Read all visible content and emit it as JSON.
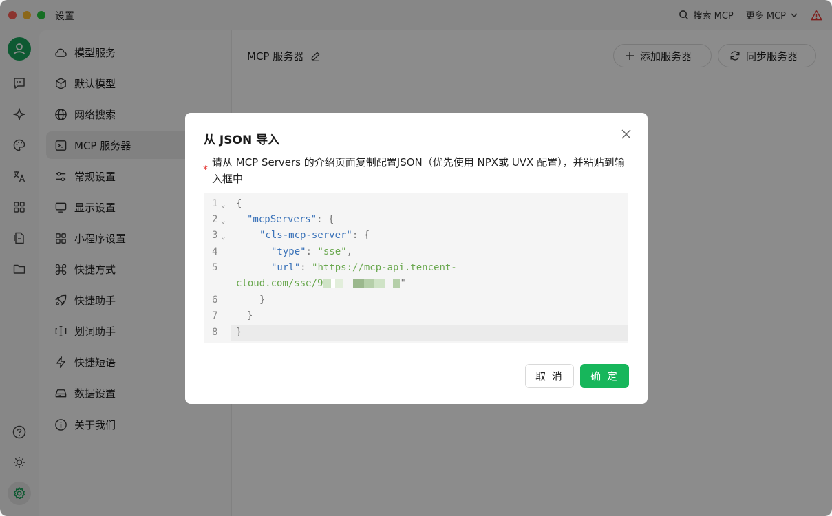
{
  "window": {
    "title": "设置"
  },
  "titlebar": {
    "search_mcp": "搜索 MCP",
    "more_mcp": "更多 MCP"
  },
  "rail": {
    "icons": [
      "user-icon",
      "chat-icon",
      "sparkle-icon",
      "palette-icon",
      "translate-icon",
      "apps-icon",
      "file-icon",
      "folder-icon",
      "help-icon",
      "brightness-icon",
      "settings-icon"
    ]
  },
  "nav": {
    "items": [
      {
        "label": "模型服务",
        "icon": "cloud-icon"
      },
      {
        "label": "默认模型",
        "icon": "cube-icon"
      },
      {
        "label": "网络搜索",
        "icon": "globe-icon"
      },
      {
        "label": "MCP 服务器",
        "icon": "terminal-icon",
        "active": true
      },
      {
        "label": "常规设置",
        "icon": "sliders-icon"
      },
      {
        "label": "显示设置",
        "icon": "monitor-icon"
      },
      {
        "label": "小程序设置",
        "icon": "grid-icon"
      },
      {
        "label": "快捷方式",
        "icon": "command-icon"
      },
      {
        "label": "快捷助手",
        "icon": "rocket-icon"
      },
      {
        "label": "划词助手",
        "icon": "text-cursor-icon"
      },
      {
        "label": "快捷短语",
        "icon": "zap-icon"
      },
      {
        "label": "数据设置",
        "icon": "hard-drive-icon"
      },
      {
        "label": "关于我们",
        "icon": "info-icon"
      }
    ]
  },
  "main": {
    "title": "MCP 服务器",
    "add_server": "添加服务器",
    "sync_server": "同步服务器"
  },
  "modal": {
    "title": "从 JSON 导入",
    "required_mark": "*",
    "description": "请从 MCP Servers 的介绍页面复制配置JSON（优先使用 NPX或 UVX 配置），并粘贴到输入框中",
    "code": {
      "line_numbers": [
        "1",
        "2",
        "3",
        "4",
        "5",
        "6",
        "7",
        "8"
      ],
      "l1": "{",
      "l2_key": "\"mcpServers\"",
      "l2_rest": ": {",
      "l3_key": "\"cls-mcp-server\"",
      "l3_rest": ": {",
      "l4_key": "\"type\"",
      "l4_sep": ": ",
      "l4_val": "\"sse\"",
      "l4_end": ",",
      "l5_key": "\"url\"",
      "l5_sep": ": ",
      "l5_val": "\"https://mcp-api.tencent-",
      "l5b_val": "cloud.com/sse/9",
      "l5b_end": "\"",
      "l6": "}",
      "l7": "}",
      "l8": "}"
    },
    "cancel": "取 消",
    "confirm": "确 定"
  }
}
